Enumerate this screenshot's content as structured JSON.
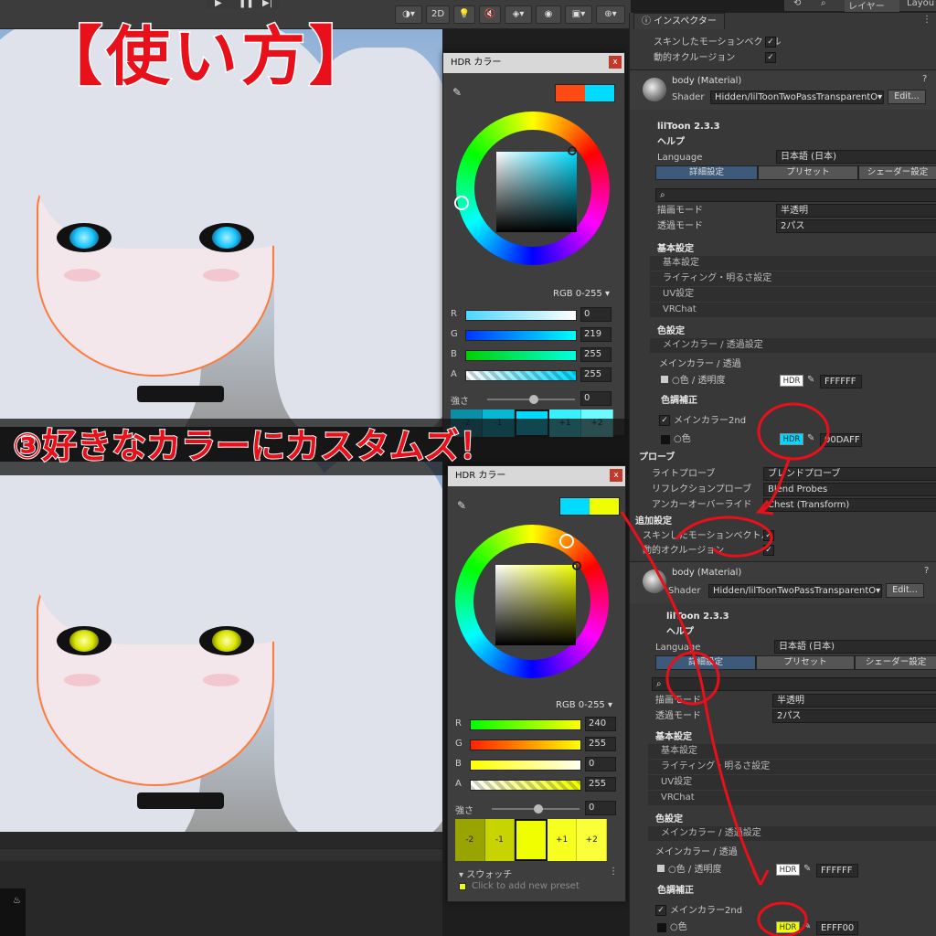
{
  "banner_title": "【使い方】",
  "step_banner": "③好きなカラーにカスタムズ！",
  "toolbar": {
    "mode_2d": "2D",
    "layer_label": "レイヤー",
    "layout_label": "Layou"
  },
  "hdr_top": {
    "title": "HDR カラー",
    "close": "x",
    "swatch_old": "#ff4a14",
    "swatch_new": "#00dbff",
    "square_hue": "#00dbff",
    "mode": "RGB 0-255 ▾",
    "sliders": [
      {
        "label": "R",
        "value": "0"
      },
      {
        "label": "G",
        "value": "219"
      },
      {
        "label": "B",
        "value": "255"
      },
      {
        "label": "A",
        "value": "255"
      }
    ],
    "intensity_label": "強さ",
    "intensity_value": "0",
    "presets": [
      "-2",
      "-1",
      "",
      "+1",
      "+2"
    ]
  },
  "hdr_bot": {
    "title": "HDR カラー",
    "close": "x",
    "swatch_old": "#00dbff",
    "swatch_new": "#f0ff00",
    "square_hue": "#f0ff00",
    "mode": "RGB 0-255 ▾",
    "sliders": [
      {
        "label": "R",
        "value": "240"
      },
      {
        "label": "G",
        "value": "255"
      },
      {
        "label": "B",
        "value": "0"
      },
      {
        "label": "A",
        "value": "255"
      }
    ],
    "intensity_label": "強さ",
    "intensity_value": "0",
    "presets": [
      "-2",
      "-1",
      "",
      "+1",
      "+2"
    ],
    "swatch_header": "▾ スウォッチ",
    "swatch_hint": "Click to add new preset"
  },
  "inspector": {
    "tab": "ⓘ インスペクター",
    "top_rows": [
      "スキンしたモーションベクトル",
      "動的オクルージョン"
    ],
    "material_name": "body (Material)",
    "shader_label": "Shader",
    "shader_value": "Hidden/lilToonTwoPassTransparentO▾",
    "edit_button": "Edit...",
    "liltoon_version": "lilToon 2.3.3",
    "help": "ヘルプ",
    "language_label": "Language",
    "language_value": "日本語 (日本)",
    "tabs": [
      "詳細設定",
      "プリセット",
      "シェーダー設定"
    ],
    "render_mode_label": "描画モード",
    "render_mode_value": "半透明",
    "transparency_label": "透過モード",
    "transparency_value": "2パス",
    "basic_settings": "基本設定",
    "basic_items": [
      "基本設定",
      "ライティング・明るさ設定",
      "UV設定",
      "VRChat"
    ],
    "color_settings": "色設定",
    "main_color_section": "メインカラー / 透過設定",
    "main_color_sub": "メインカラー / 透過",
    "color_alpha_label": "○色 / 透明度",
    "color_alpha_hex": "FFFFFF",
    "color_correction": "色調補正",
    "main_color_2nd": "メインカラー2nd",
    "color_label": "○色",
    "color2_hex_top": "00DAFF",
    "color2_hex_bot": "EFFF00",
    "hdr_badge": "HDR",
    "light_probe_label": "ライトプローブ",
    "light_probe_value": "ブレンドプローブ",
    "reflection_probe_label": "リフレクションプローブ",
    "reflection_probe_value": "Blend Probes",
    "anchor_override_label": "アンカーオーバーライド",
    "anchor_override_value": "Chest (Transform)",
    "probe_header": "プローブ",
    "extra_settings": "追加設定",
    "skinned_motion": "スキンしたモーションベクトル",
    "dynamic_occlusion": "動的オクルージョン"
  },
  "colors": {
    "accent_red": "#e8101a",
    "cyan": "#00dbff",
    "yellow": "#f0ff00",
    "panel": "#383838"
  }
}
